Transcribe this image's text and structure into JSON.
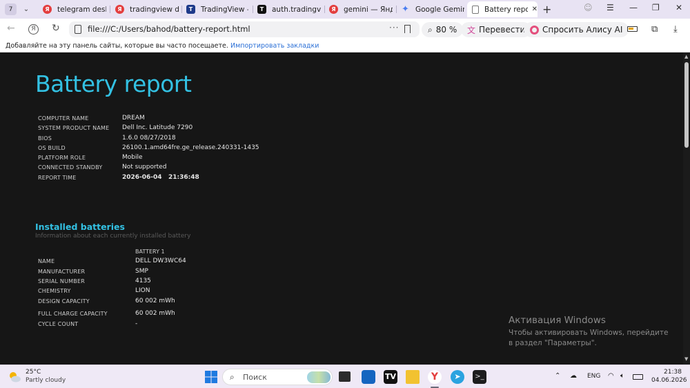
{
  "browser": {
    "tab_count": "7",
    "tabs": [
      {
        "label": "telegram deskto",
        "icon": "yandex-icon",
        "color": "#e33e3e"
      },
      {
        "label": "tradingview dov",
        "icon": "yandex-icon",
        "color": "#e33e3e"
      },
      {
        "label": "TradingView — ",
        "icon": "tradingview-icon",
        "color": "#1e3a8a"
      },
      {
        "label": "auth.tradingviev",
        "icon": "tradingview-icon",
        "color": "#111111"
      },
      {
        "label": "gemini — Яндек",
        "icon": "yandex-icon",
        "color": "#e33e3e"
      },
      {
        "label": "Google Gemini",
        "icon": "gemini-icon",
        "color": "#4a7df0"
      },
      {
        "label": "Battery repor",
        "icon": "document-icon",
        "color": "#777777"
      }
    ],
    "url": "file:///C:/Users/bahod/battery-report.html",
    "zoom": "80 %",
    "translate_label": "Перевести",
    "alice_label": "Спросить Алису AI",
    "bookmarks_hint": "Добавляйте на эту панель сайты, которые вы часто посещаете.",
    "bookmarks_import": "Импортировать закладки"
  },
  "report": {
    "title": "Battery report",
    "system_info": [
      {
        "label": "COMPUTER NAME",
        "value": "DREAM"
      },
      {
        "label": "SYSTEM PRODUCT NAME",
        "value": "Dell Inc. Latitude 7290"
      },
      {
        "label": "BIOS",
        "value": "1.6.0 08/27/2018"
      },
      {
        "label": "OS BUILD",
        "value": "26100.1.amd64fre.ge_release.240331-1435"
      },
      {
        "label": "PLATFORM ROLE",
        "value": "Mobile"
      },
      {
        "label": "CONNECTED STANDBY",
        "value": "Not supported"
      },
      {
        "label": "REPORT TIME",
        "value": "2026-06-04   21:36:48"
      }
    ],
    "installed_batteries": {
      "title": "Installed batteries",
      "subtitle": "Information about each currently installed battery",
      "column_header": "BATTERY 1",
      "rows": [
        {
          "label": "NAME",
          "value": "DELL DW3WC64"
        },
        {
          "label": "MANUFACTURER",
          "value": "SMP"
        },
        {
          "label": "SERIAL NUMBER",
          "value": "4135"
        },
        {
          "label": "CHEMISTRY",
          "value": "LION"
        },
        {
          "label": "DESIGN CAPACITY",
          "value": "60 002 mWh"
        },
        {
          "label": "FULL CHARGE CAPACITY",
          "value": "60 002 mWh"
        },
        {
          "label": "CYCLE COUNT",
          "value": "-"
        }
      ]
    }
  },
  "activation": {
    "heading": "Активация Windows",
    "text": "Чтобы активировать Windows, перейдите в раздел \"Параметры\"."
  },
  "taskbar": {
    "weather_temp": "25°C",
    "weather_condition": "Partly cloudy",
    "search_placeholder": "Поиск",
    "language": "ENG",
    "time": "21:38",
    "date": "04.06.2026"
  },
  "colors": {
    "accent": "#33c1e3",
    "page_background": "#161616"
  }
}
